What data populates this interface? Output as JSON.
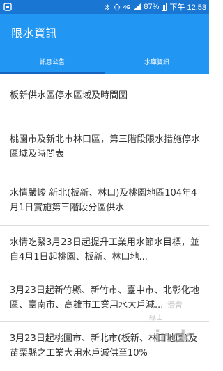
{
  "status_bar": {
    "network_label": "4G",
    "battery_percent": "87%",
    "time": "下午 12:53",
    "icons": [
      "app-notification-icon",
      "bluetooth-icon",
      "vibrate-icon",
      "network-4g-icon",
      "signal-icon",
      "battery-icon"
    ],
    "background_color": "#1976d2"
  },
  "app_bar": {
    "title": "限水資訊",
    "background_color": "#2196f3"
  },
  "tabs": [
    {
      "label": "訊息公告",
      "active": true
    },
    {
      "label": "水庫資訊",
      "active": false
    }
  ],
  "list": {
    "items": [
      {
        "text": "板新供水區停水區域及時間圖"
      },
      {
        "text": "桃園市及新北市林口區，第三階段限水措施停水區域及時間表"
      },
      {
        "text": "水情嚴峻 新北(板新、林口)及桃園地區104年4月1日實施第三階段分區供水"
      },
      {
        "text": "水情吃緊3月23日起提升工業用水節水目標，並自4月1日起桃園、板新、林口地..."
      },
      {
        "text": "3月23日起新竹縣、新竹市、臺中市、北彰化地區、臺南市、高雄市工業用水大戶減..."
      },
      {
        "text": "3月23日起桃園市、新北市(板新、林口地區)及苗栗縣之工業大用水戶減供至10%"
      }
    ]
  },
  "watermark": {
    "line1": "滑音",
    "line2": "綠山",
    "big": "inck"
  }
}
